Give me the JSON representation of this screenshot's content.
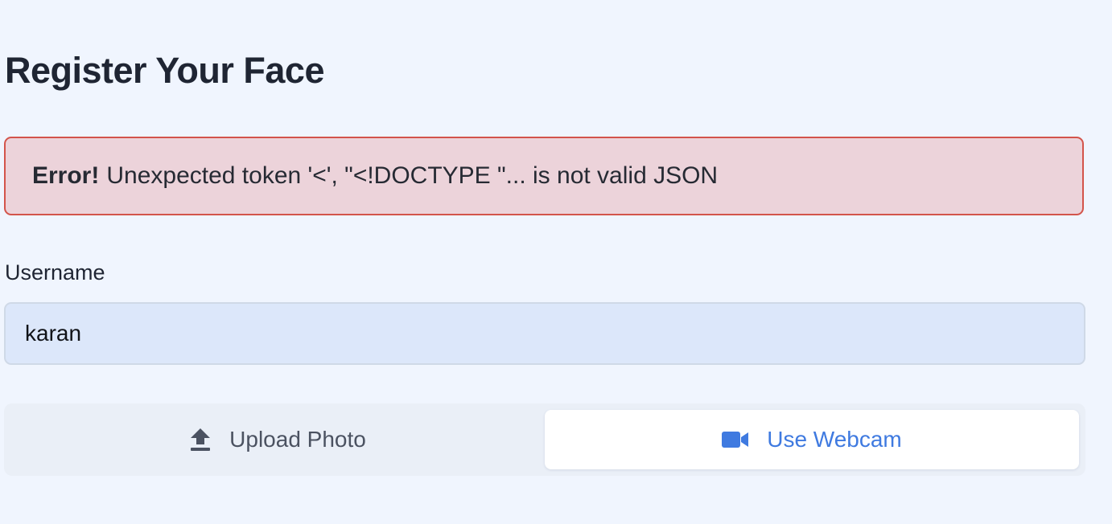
{
  "page": {
    "title": "Register Your Face"
  },
  "alert": {
    "strong": "Error!",
    "message": "Unexpected token '<', \"<!DOCTYPE \"... is not valid JSON",
    "color": "#d3544b"
  },
  "form": {
    "username_label": "Username",
    "username_value": "karan"
  },
  "tabs": [
    {
      "label": "Upload Photo",
      "icon": "upload-icon",
      "active": false
    },
    {
      "label": "Use Webcam",
      "icon": "video-camera-icon",
      "active": true
    }
  ],
  "colors": {
    "accent": "#3f7ae0",
    "background": "#f0f5fe"
  }
}
